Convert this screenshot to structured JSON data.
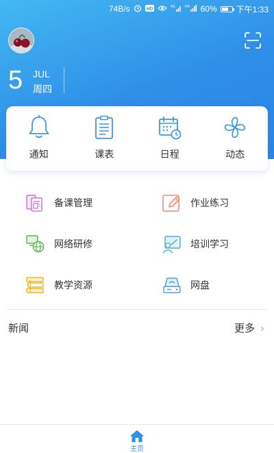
{
  "status_bar": {
    "speed": "74B/s",
    "battery": "60%",
    "time": "下午1:33",
    "icons": [
      "alarm-icon",
      "hd-icon",
      "eye-icon",
      "4g-signal-icon",
      "signal-icon",
      "battery-icon"
    ]
  },
  "header": {
    "avatar": "avatar",
    "scan_icon": "scan-icon",
    "date": {
      "day": "5",
      "month": "JUL",
      "weekday": "周四"
    }
  },
  "quick_actions": [
    {
      "label": "通知",
      "icon": "bell-icon"
    },
    {
      "label": "课表",
      "icon": "clipboard-icon"
    },
    {
      "label": "日程",
      "icon": "calendar-clock-icon"
    },
    {
      "label": "动态",
      "icon": "pinwheel-icon"
    }
  ],
  "features": [
    {
      "label": "备课管理",
      "icon": "lesson-prep-icon"
    },
    {
      "label": "作业练习",
      "icon": "homework-edit-icon"
    },
    {
      "label": "网络研修",
      "icon": "network-study-icon"
    },
    {
      "label": "培训学习",
      "icon": "training-icon"
    },
    {
      "label": "教学资源",
      "icon": "teaching-resources-icon"
    },
    {
      "label": "网盘",
      "icon": "cloud-drive-icon"
    }
  ],
  "news": {
    "title": "新闻",
    "more": "更多"
  },
  "tabbar": {
    "home_label": "主页",
    "home_icon": "home-icon"
  },
  "colors": {
    "accent": "#2d91e8",
    "header_top": "#43b8f2",
    "header_bottom": "#2b84e6"
  }
}
